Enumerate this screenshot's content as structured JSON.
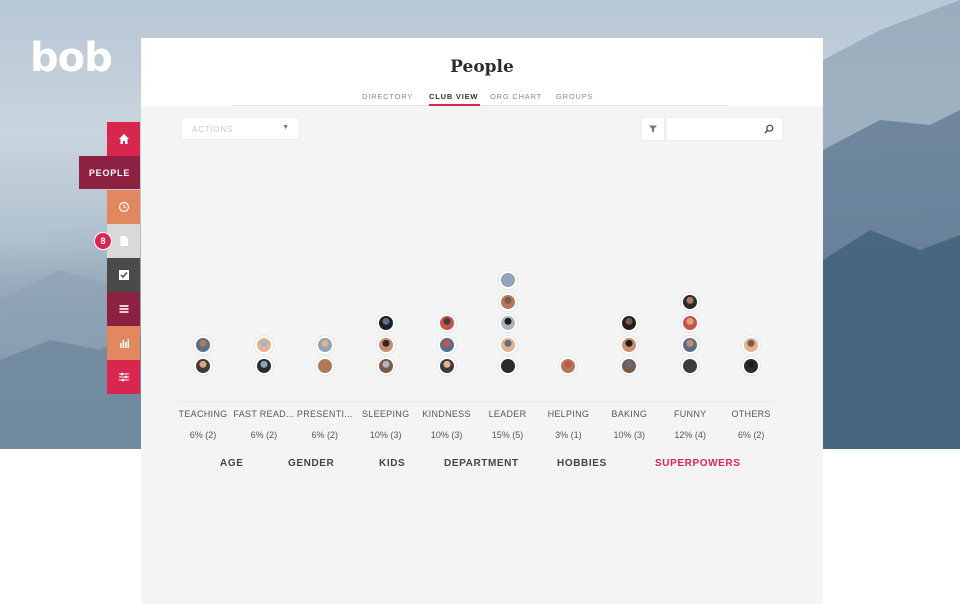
{
  "app": {
    "logo": "bob"
  },
  "colors": {
    "accent": "#d8264f",
    "people_active": "#8c2141"
  },
  "sidebar": {
    "items": [
      {
        "id": "home",
        "icon": "home-icon",
        "color": "#d8264f"
      },
      {
        "id": "people",
        "label": "PEOPLE",
        "color": "#8c2141"
      },
      {
        "id": "time-off",
        "icon": "clock-icon",
        "color": "#e3885e"
      },
      {
        "id": "documents",
        "icon": "document-icon",
        "color": "#d9d9d9",
        "badge": "8"
      },
      {
        "id": "tasks",
        "icon": "checkbox-icon",
        "color": "#4a4a4a"
      },
      {
        "id": "payroll",
        "icon": "stack-icon",
        "color": "#8c2141"
      },
      {
        "id": "analytics",
        "icon": "bar-chart-icon",
        "color": "#e3885e"
      },
      {
        "id": "settings",
        "icon": "sliders-icon",
        "color": "#d8264f"
      }
    ]
  },
  "header": {
    "title": "People",
    "tabs": [
      {
        "label": "DIRECTORY",
        "active": false
      },
      {
        "label": "CLUB VIEW",
        "active": true
      },
      {
        "label": "ORG CHART",
        "active": false
      },
      {
        "label": "GROUPS",
        "active": false
      }
    ]
  },
  "toolbar": {
    "actions_placeholder": "ACTIONS",
    "search_value": "",
    "filter_icon": "filter-icon",
    "search_icon": "search-icon"
  },
  "club": {
    "categories": [
      {
        "name": "TEACHING",
        "value": "6% (2)",
        "count": 2
      },
      {
        "name": "FAST READ...",
        "value": "6% (2)",
        "count": 2
      },
      {
        "name": "PRESENTI...",
        "value": "6% (2)",
        "count": 2
      },
      {
        "name": "SLEEPING",
        "value": "10% (3)",
        "count": 3
      },
      {
        "name": "KINDNESS",
        "value": "10% (3)",
        "count": 3
      },
      {
        "name": "LEADER",
        "value": "15% (5)",
        "count": 5
      },
      {
        "name": "HELPING",
        "value": "3% (1)",
        "count": 1
      },
      {
        "name": "BAKING",
        "value": "10% (3)",
        "count": 3
      },
      {
        "name": "FUNNY",
        "value": "12% (4)",
        "count": 4
      },
      {
        "name": "OTHERS",
        "value": "6% (2)",
        "count": 2
      }
    ]
  },
  "dimensions": [
    {
      "label": "AGE",
      "active": false
    },
    {
      "label": "GENDER",
      "active": false
    },
    {
      "label": "KIDS",
      "active": false
    },
    {
      "label": "DEPARTMENT",
      "active": false
    },
    {
      "label": "HOBBIES",
      "active": false
    },
    {
      "label": "SUPERPOWERS",
      "active": true
    }
  ]
}
